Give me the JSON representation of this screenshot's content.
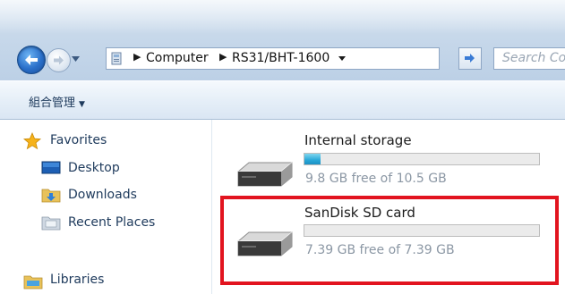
{
  "address_bar": {
    "crumbs": [
      "Computer",
      "RS31/BHT-1600"
    ]
  },
  "search": {
    "placeholder": "Search Co"
  },
  "command_bar": {
    "organize_label": "組合管理"
  },
  "nav": {
    "items": [
      {
        "label": "Favorites",
        "icon": "star-icon"
      },
      {
        "label": "Desktop",
        "icon": "desktop-icon"
      },
      {
        "label": "Downloads",
        "icon": "downloads-folder-icon"
      },
      {
        "label": "Recent Places",
        "icon": "recent-places-icon"
      },
      {
        "label": "Libraries",
        "icon": "libraries-icon"
      }
    ]
  },
  "drives": [
    {
      "name": "Internal storage",
      "free_text": "9.8 GB free of 10.5 GB",
      "used_fraction": 0.067
    },
    {
      "name": "SanDisk SD card",
      "free_text": "7.39 GB free of 7.39 GB",
      "used_fraction": 0.0,
      "highlighted": true
    }
  ],
  "colors": {
    "highlight": "#e2141f",
    "bar_fill": "#28a8d8"
  }
}
